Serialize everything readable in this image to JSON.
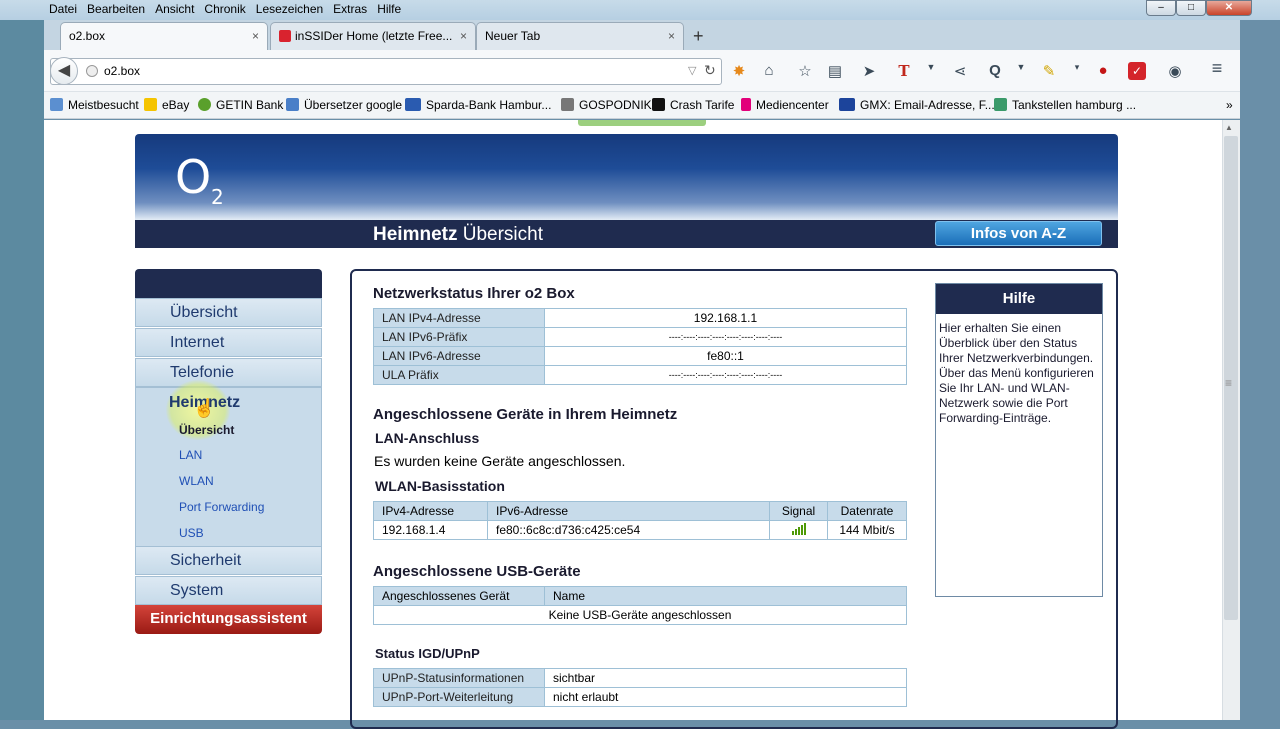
{
  "menu": [
    "Datei",
    "Bearbeiten",
    "Ansicht",
    "Chronik",
    "Lesezeichen",
    "Extras",
    "Hilfe"
  ],
  "window_controls": {
    "minimize": "–",
    "maximize": "□",
    "close": "✕"
  },
  "tabs": [
    {
      "label": "o2.box",
      "close": "×"
    },
    {
      "label": "inSSIDer Home (letzte Free...",
      "close": "×"
    },
    {
      "label": "Neuer Tab",
      "close": "×"
    }
  ],
  "new_tab": "+",
  "url": "o2.box",
  "bookmarks": [
    "Meistbesucht",
    "eBay",
    "GETIN Bank",
    "Übersetzer google",
    "Sparda-Bank Hambur...",
    "GOSPODNIK",
    "Crash Tarife",
    "Mediencenter",
    "GMX: Email-Adresse, F...",
    "Tankstellen hamburg ..."
  ],
  "bookmarks_more": "»",
  "logo": {
    "main": "O",
    "sub": "2"
  },
  "title_bold": "Heimnetz",
  "title_rest": " Übersicht",
  "infos_button": "Infos von A-Z",
  "sidebar": {
    "items": [
      "Übersicht",
      "Internet",
      "Telefonie",
      "Heimnetz",
      "Sicherheit",
      "System"
    ],
    "subitems": [
      "Übersicht",
      "LAN",
      "WLAN",
      "Port Forwarding",
      "USB"
    ],
    "assistant": "Einrichtungsassistent"
  },
  "netzwerkstatus": {
    "title": "Netzwerkstatus Ihrer o2 Box",
    "rows": [
      [
        "LAN IPv4-Adresse",
        "192.168.1.1"
      ],
      [
        "LAN IPv6-Präfix",
        "----:----:----:----:----:----:----:----"
      ],
      [
        "LAN IPv6-Adresse",
        "fe80::1"
      ],
      [
        "ULA Präfix",
        "----:----:----:----:----:----:----:----"
      ]
    ]
  },
  "geraete": {
    "title": "Angeschlossene Geräte in Ihrem Heimnetz",
    "lan_title": "LAN-Anschluss",
    "lan_text": "Es wurden keine Geräte angeschlossen.",
    "wlan_title": "WLAN-Basisstation",
    "wlan_headers": [
      "IPv4-Adresse",
      "IPv6-Adresse",
      "Signal",
      "Datenrate"
    ],
    "wlan_row": {
      "ipv4": "192.168.1.4",
      "ipv6": "fe80::6c8c:d736:c425:ce54",
      "rate": "144 Mbit/s",
      "signal_bars": 5
    }
  },
  "usb": {
    "title": "Angeschlossene USB-Geräte",
    "headers": [
      "Angeschlossenes Gerät",
      "Name"
    ],
    "empty": "Keine USB-Geräte angeschlossen"
  },
  "igd": {
    "title": "Status IGD/UPnP",
    "rows": [
      [
        "UPnP-Statusinformationen",
        "sichtbar"
      ],
      [
        "UPnP-Port-Weiterleitung",
        "nicht erlaubt"
      ]
    ]
  },
  "help": {
    "title": "Hilfe",
    "text": "Hier erhalten Sie einen Überblick über den Status Ihrer Netzwerkverbindungen. Über das Menü konfigurieren Sie Ihr LAN- und WLAN-Netzwerk sowie die Port Forwarding-Einträge."
  }
}
